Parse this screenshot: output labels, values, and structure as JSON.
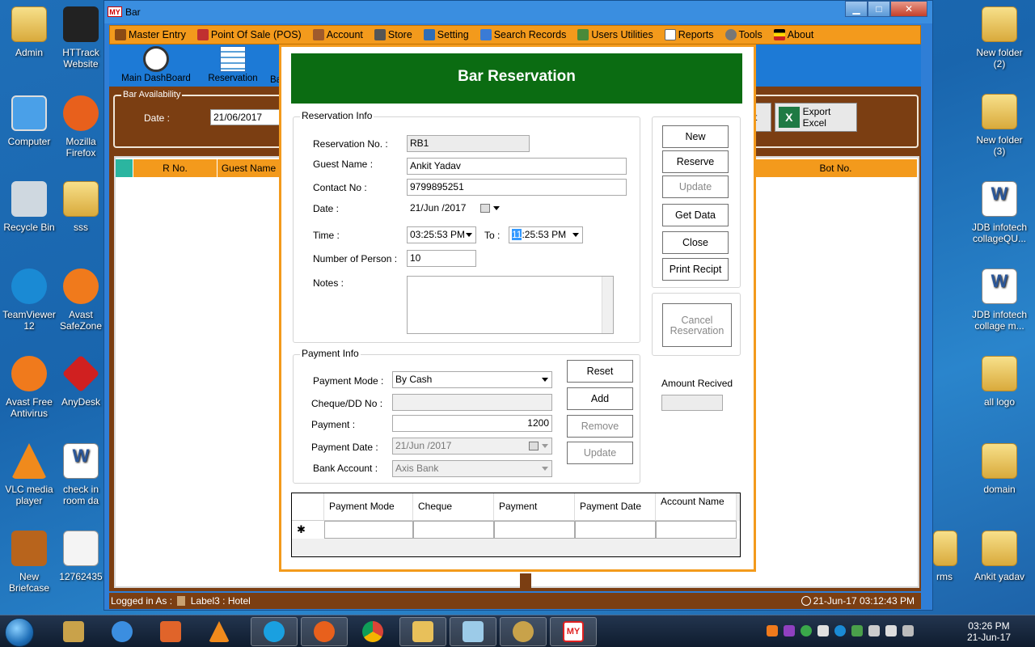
{
  "desktop": {
    "left_icons": [
      {
        "label": "Admin"
      },
      {
        "label": "HTTrack Website"
      },
      {
        "label": "Computer"
      },
      {
        "label": "Mozilla Firefox"
      },
      {
        "label": "Recycle Bin"
      },
      {
        "label": "sss"
      },
      {
        "label": "TeamViewer 12"
      },
      {
        "label": "Avast SafeZone"
      },
      {
        "label": "Avast Free Antivirus"
      },
      {
        "label": "AnyDesk"
      },
      {
        "label": "VLC media player"
      },
      {
        "label": "check in room da"
      },
      {
        "label": "New Briefcase"
      },
      {
        "label": "12762435"
      }
    ],
    "right_icons": [
      {
        "label": "New folder (2)"
      },
      {
        "label": "New folder (3)"
      },
      {
        "label": "JDB infotech collageQU..."
      },
      {
        "label": "JDB infotech collage m..."
      },
      {
        "label": "all logo"
      },
      {
        "label": "domain"
      },
      {
        "label": "Ankit yadav"
      },
      {
        "label": "rms"
      }
    ]
  },
  "window": {
    "title": "Bar",
    "badge": "MY",
    "min": "▁",
    "max": "□",
    "close": "✕"
  },
  "menu": [
    {
      "label": "Master Entry",
      "color": "#8b4a14"
    },
    {
      "label": "Point Of Sale (POS)",
      "color": "#c03030"
    },
    {
      "label": "Account",
      "color": "#a05a2c"
    },
    {
      "label": "Store",
      "color": "#555555"
    },
    {
      "label": "Setting",
      "color": "#2f6db5"
    },
    {
      "label": "Search Records",
      "color": "#3a7bd5"
    },
    {
      "label": "Users Utilities",
      "color": "#4a8a3a"
    },
    {
      "label": "Reports",
      "color": "#666666"
    },
    {
      "label": "Tools",
      "color": "#777777"
    },
    {
      "label": "About",
      "color": "#cc2222"
    }
  ],
  "toolbar": {
    "main_dashboard": "Main DashBoard",
    "reservation": "Reservation",
    "partial": "Ba"
  },
  "bar_availability": {
    "legend": "Bar Availability",
    "date_label": "Date :",
    "date_value": "21/06/2017",
    "partial_btn": "t",
    "export": "Export Excel",
    "export_icon": "X"
  },
  "grid": {
    "columns": [
      "R No.",
      "Guest Name",
      "Bot No."
    ]
  },
  "status": {
    "left": "Logged in As :",
    "label": "Label3",
    "sep": ":",
    "role": "Hotel",
    "datetime": "21-Jun-17 03:12:43 PM"
  },
  "dialog": {
    "title": "Bar Reservation",
    "reservation_info": {
      "group": "Reservation Info",
      "reservation_no_label": "Reservation No. :",
      "reservation_no": "RB1",
      "guest_name_label": "Guest Name :",
      "guest_name": "Ankit Yadav",
      "contact_label": "Contact No :",
      "contact": "9799895251",
      "date_label": "Date :",
      "date": "21/Jun /2017",
      "time_label": "Time :",
      "time_from": "03:25:53 PM",
      "to_label": "To :",
      "time_to_hour": "11",
      "time_to_rest": ":25:53 PM",
      "persons_label": "Number of Person :",
      "persons": "10",
      "notes_label": "Notes :"
    },
    "actions": {
      "new": "New",
      "reserve": "Reserve",
      "update": "Update",
      "get_data": "Get Data",
      "close": "Close",
      "print": "Print Recipt",
      "cancel_reservation": "Cancel Reservation"
    },
    "amount_received_label": "Amount Recived",
    "payment_info": {
      "group": "Payment Info",
      "mode_label": "Payment Mode :",
      "mode": "By Cash",
      "cheque_label": "Cheque/DD No :",
      "payment_label": "Payment :",
      "payment": "1200",
      "payment_date_label": "Payment Date :",
      "payment_date": "21/Jun /2017",
      "bank_label": "Bank Account :",
      "bank": "Axis Bank",
      "reset": "Reset",
      "add": "Add",
      "remove": "Remove",
      "update": "Update"
    },
    "payment_grid": {
      "columns": [
        "Payment Mode",
        "Cheque",
        "Payment",
        "Payment Date",
        "Account Name"
      ],
      "new_row_marker": "✱"
    }
  },
  "taskbar": {
    "time": "03:26 PM",
    "date": "21-Jun-17",
    "apps": [
      {
        "name": "tools",
        "color": "#c9a24a"
      },
      {
        "name": "ie",
        "color": "#3b8ee0"
      },
      {
        "name": "media",
        "color": "#e0642a"
      },
      {
        "name": "vlc",
        "color": "#f08a1c"
      },
      {
        "name": "skype",
        "color": "#1aa0e0"
      },
      {
        "name": "firefox",
        "color": "#e8601c"
      },
      {
        "name": "chrome",
        "color": "#3aa84a"
      },
      {
        "name": "explorer",
        "color": "#e8c05a"
      },
      {
        "name": "notepad",
        "color": "#9ccbe8"
      },
      {
        "name": "paint",
        "color": "#c8a24a"
      },
      {
        "name": "myhotel",
        "color": "#e02020"
      }
    ]
  }
}
